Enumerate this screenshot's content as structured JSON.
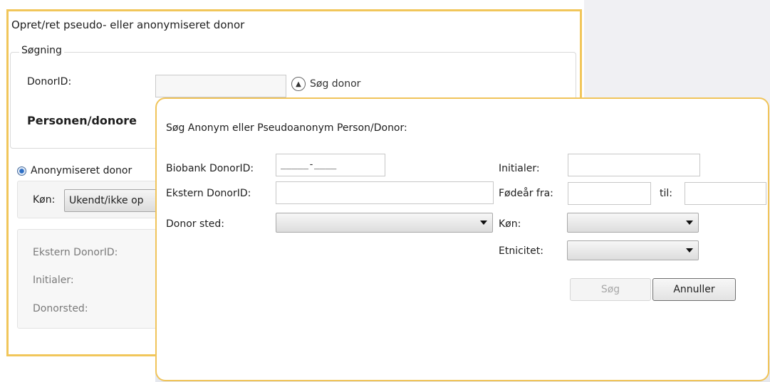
{
  "back_window": {
    "title": "Opret/ret pseudo- eller anonymiseret donor",
    "search_group": {
      "legend": "Søgning",
      "donorid_label": "DonorID:",
      "donorid_value": "",
      "search_button_label": "Søg donor"
    },
    "person_heading": "Personen/donore",
    "radio_anonymized_label": "Anonymiseret donor",
    "kon_label": "Køn:",
    "kon_value": "Ukendt/ikke op",
    "info_labels": {
      "ekstern": "Ekstern DonorID:",
      "initialer": "Initialer:",
      "donorsted": "Donorsted:"
    }
  },
  "dialog": {
    "title": "Søg Anonym eller Pseudoanonym Person/Donor:",
    "biobank_label": "Biobank DonorID:",
    "biobank_mask": "_____-____",
    "ekstern_label": "Ekstern DonorID:",
    "ekstern_value": "",
    "donor_sted_label": "Donor sted:",
    "donor_sted_value": "",
    "initialer_label": "Initialer:",
    "initialer_value": "",
    "fodear_label": "Fødeår fra:",
    "fodear_from_value": "",
    "til_label": "til:",
    "fodear_to_value": "",
    "kon_label": "Køn:",
    "kon_value": "",
    "etnicitet_label": "Etnicitet:",
    "etnicitet_value": "",
    "search_button": "Søg",
    "cancel_button": "Annuller"
  }
}
